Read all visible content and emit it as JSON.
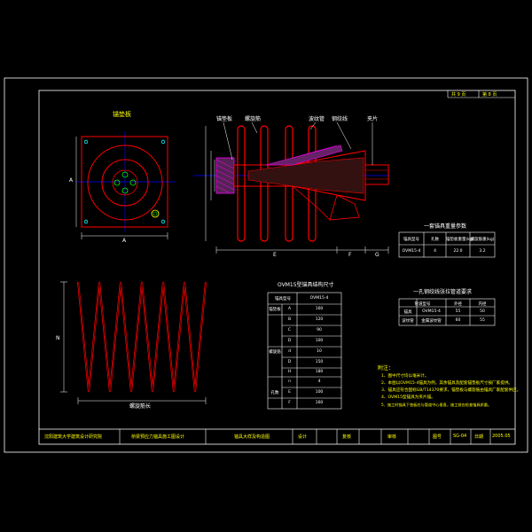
{
  "views": {
    "plan_title": "锚垫板",
    "spiral_len_label": "螺旋筋长",
    "spiral_label_n": "N",
    "plan_dim_bottom": "A",
    "plan_dim_left": "A"
  },
  "callouts": {
    "c1": "锚垫板",
    "c2": "螺旋筋",
    "c3": "波纹管",
    "c4": "钢绞线",
    "c5": "夹片"
  },
  "elev_dims": {
    "d1": "E",
    "d2": "F",
    "d3": "G"
  },
  "table1": {
    "title": "一套锚具重量参数",
    "headers": [
      "锚具型号",
      "孔数",
      "锚垫板重量(kg)",
      "螺旋筋重(kg)"
    ],
    "row": [
      "OVM15-4",
      "4",
      "22.0",
      "3.2"
    ]
  },
  "table2": {
    "title": "一孔钢绞线张拉管道要求",
    "headers": [
      "管道型号",
      "外径",
      "内径"
    ],
    "rows": [
      [
        "锚具",
        "OVM15-4",
        "55",
        "50"
      ],
      [
        "波纹管",
        "金属波纹管",
        "60",
        "55"
      ]
    ]
  },
  "table3": {
    "title": "OVM15型锚具结构尺寸",
    "headers": [
      "锚具型号",
      "OVM15-4"
    ],
    "rows": [
      [
        "锚垫板",
        "A",
        "160"
      ],
      [
        "",
        "B",
        "120"
      ],
      [
        "",
        "C",
        "90"
      ],
      [
        "",
        "D",
        "100"
      ],
      [
        "螺旋筋",
        "d",
        "10"
      ],
      [
        "",
        "D",
        "150"
      ],
      [
        "",
        "H",
        "180"
      ],
      [
        "",
        "n",
        "4"
      ],
      [
        "孔数",
        "E",
        "100"
      ],
      [
        "",
        "F",
        "160"
      ]
    ]
  },
  "notes": {
    "title": "附注：",
    "lines": [
      "1、图中尺寸均以毫米计。",
      "2、本图以OVM15-4锚具为例，其余锚具及配套锚垫板尺寸按厂家提供。",
      "3、锚具应符合国标GB/T14370要求，锚垫板与螺旋筋由锚具厂家配套供应。",
      "4、OVM15型锚具为夹片锚。",
      "5、施工时锚具下垫板应与管道中心垂直，施工前应检查锚具质量。"
    ]
  },
  "titleblock": {
    "org": "沈阳建筑大学建筑设计研究院",
    "project": "桥梁预应力锚具施工图设计",
    "drawing": "锚具大样及构造图",
    "design": "设计",
    "review": "复核",
    "approve": "审核",
    "no_label": "图号",
    "no": "SG-04",
    "date_label": "日期",
    "date": "2005.05",
    "sheet_total": "共 9 页",
    "sheet_no": "第 8 页"
  },
  "colors": {
    "border": "#ffffff",
    "part": "#ff0000",
    "dim": "#ffffff",
    "axis": "#0000ff",
    "text": "#ffff00",
    "hatch": "#ff00ff",
    "green": "#00ff00"
  }
}
